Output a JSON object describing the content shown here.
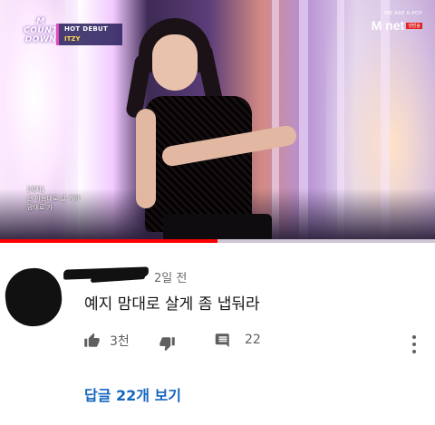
{
  "video": {
    "logo_line1": "COUNT",
    "logo_line2": "DOWN",
    "logo_top": "M",
    "banner_title": "HOT DEBUT",
    "banner_artist": "ITZY",
    "brand_sub": "WE ARE K-POP",
    "brand_main": "M net",
    "brand_tag": "생방송",
    "lyrics_line1": "[예지]",
    "lyrics_line2": "난 마음대로 살 거야",
    "lyrics_line3": "맘대로 가",
    "progress_percent": 50,
    "progress_color": "#ff0000"
  },
  "comment": {
    "time": "2일 전",
    "text": "예지 맘대로 살게 좀 냅둬라",
    "like_icon": "thumb-up-icon",
    "like_count": "3천",
    "dislike_icon": "thumb-down-icon",
    "reply_icon": "comment-icon",
    "reply_count": "22",
    "more_icon": "more-vertical-icon",
    "view_replies": "답글 22개 보기",
    "link_color": "#1565c0"
  }
}
